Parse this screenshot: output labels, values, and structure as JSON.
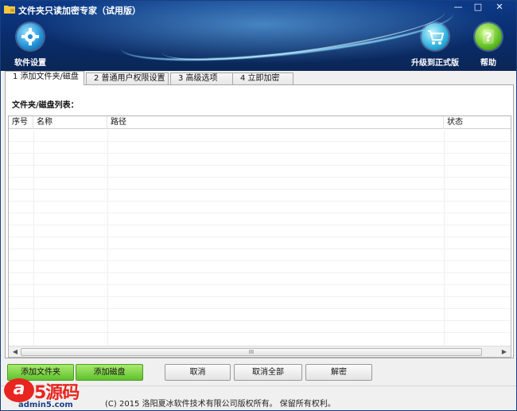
{
  "window": {
    "title": "文件夹只读加密专家（试用版）",
    "controls": [
      "—",
      "□",
      "✕"
    ]
  },
  "toolbar": {
    "settings_label": "软件设置",
    "upgrade_label": "升级到正式版",
    "help_label": "帮助"
  },
  "tabs": [
    {
      "label": "1 添加文件夹/磁盘",
      "active": true
    },
    {
      "label": "2 普通用户权限设置",
      "active": false
    },
    {
      "label": "3 高级选项",
      "active": false
    },
    {
      "label": "4 立即加密",
      "active": false
    }
  ],
  "list": {
    "caption": "文件夹/磁盘列表：",
    "columns": [
      "序号",
      "名称",
      "路径",
      "状态"
    ],
    "rows": [],
    "scroll_grip": "III"
  },
  "buttons": {
    "add_folder": "添加文件夹",
    "add_disk": "添加磁盘",
    "cancel": "取消",
    "cancel_all": "取消全部",
    "decrypt": "解密"
  },
  "status": {
    "copyright": "(C)  2015 洛阳夏冰软件技术有限公司版权所有。 保留所有权利。"
  },
  "watermark": {
    "logo": "a",
    "text": "5源码",
    "url": "admin5.com"
  },
  "colors": {
    "header": "#0a2d6e",
    "accent_green": "#5fc12e",
    "watermark_red": "#e8251f"
  }
}
